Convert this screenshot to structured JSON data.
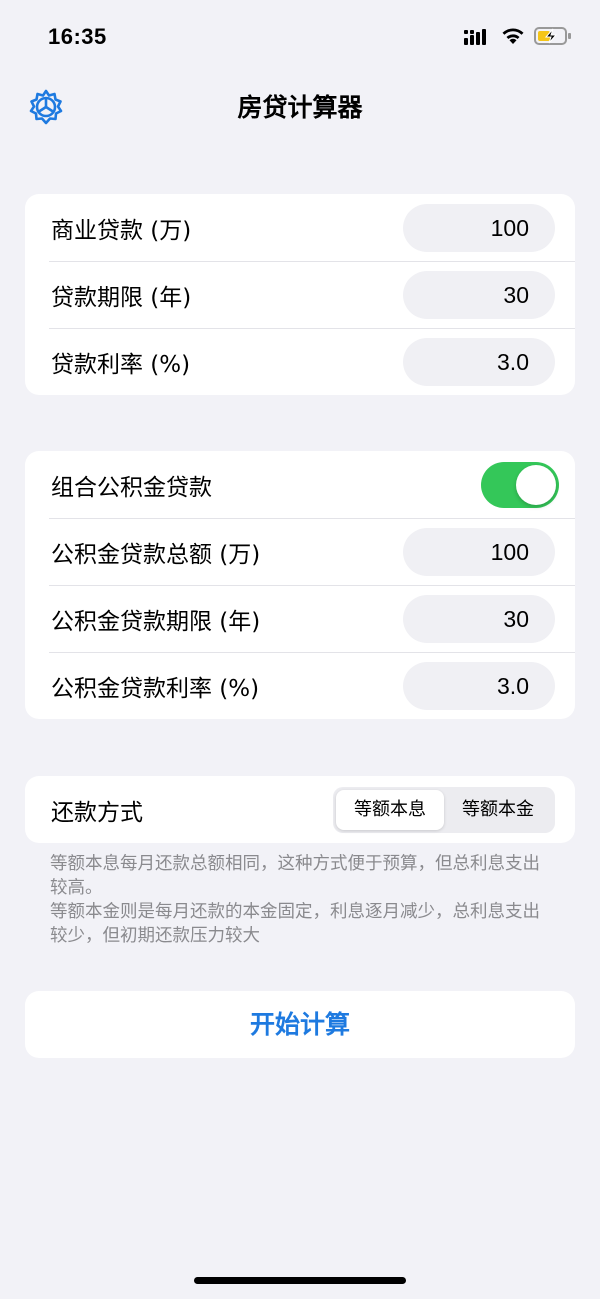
{
  "status_bar": {
    "time": "16:35"
  },
  "nav": {
    "title": "房贷计算器",
    "settings_icon": "gear-icon"
  },
  "commercial_loan": {
    "rows": [
      {
        "label": "商业贷款 (万)",
        "value": "100"
      },
      {
        "label": "贷款期限 (年)",
        "value": "30"
      },
      {
        "label": "贷款利率 (%)",
        "value": "3.0"
      }
    ]
  },
  "provident_fund": {
    "toggle_label": "组合公积金贷款",
    "toggle_on": true,
    "rows": [
      {
        "label": "公积金贷款总额 (万)",
        "value": "100"
      },
      {
        "label": "公积金贷款期限 (年)",
        "value": "30"
      },
      {
        "label": "公积金贷款利率 (%)",
        "value": "3.0"
      }
    ]
  },
  "repayment": {
    "label": "还款方式",
    "options": [
      "等额本息",
      "等额本金"
    ],
    "selected": "等额本息"
  },
  "note": {
    "line1": "等额本息每月还款总额相同，这种方式便于预算，但总利息支出较高。",
    "line2": "等额本金则是每月还款的本金固定，利息逐月减少，总利息支出较少，但初期还款压力较大"
  },
  "calculate_button": "开始计算",
  "colors": {
    "accent": "#1e7ae0",
    "toggle_on": "#34c759",
    "background": "#f2f2f7"
  }
}
